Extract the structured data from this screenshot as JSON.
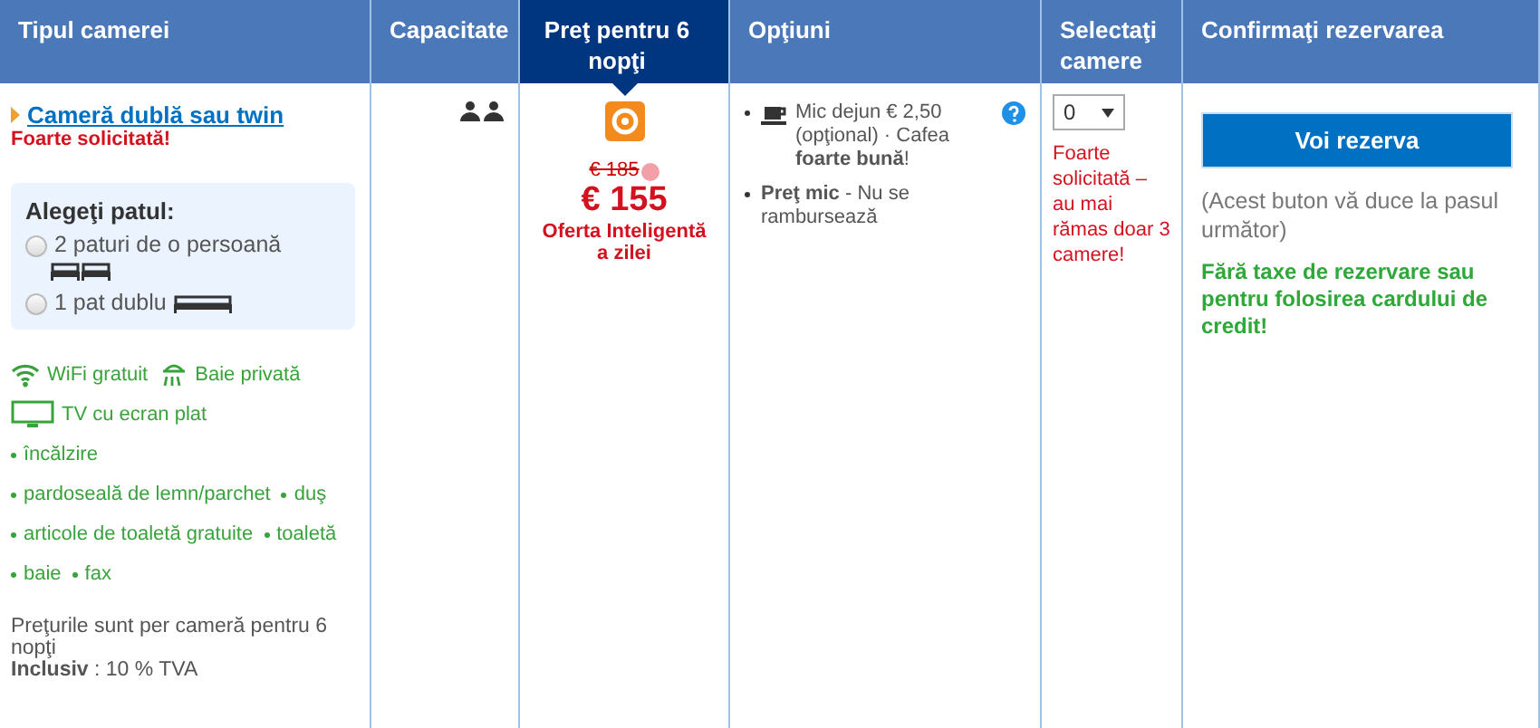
{
  "columns": [
    {
      "label": "Tipul camerei",
      "selected": false
    },
    {
      "label": "Capacitate",
      "selected": false
    },
    {
      "label": "Preţ pentru 6 nopţi",
      "selected": true
    },
    {
      "label": "Opţiuni",
      "selected": false
    },
    {
      "label": "Selectaţi camere",
      "selected": false
    },
    {
      "label": "Confirmaţi rezervarea",
      "selected": false
    }
  ],
  "room": {
    "name": "Cameră dublă sau twin",
    "demand": "Foarte solicitată!",
    "bed_choice": {
      "title": "Alegeţi patul:",
      "options": [
        {
          "label": "2 paturi de o persoană",
          "selected": false,
          "kind": "twin"
        },
        {
          "label": "1 pat dublu",
          "selected": false,
          "kind": "double"
        }
      ]
    },
    "facility_lines": [
      [
        {
          "label": "WiFi gratuit",
          "kind": "wifi"
        },
        {
          "label": "Baie privată",
          "kind": "bath"
        }
      ],
      [
        {
          "label": "TV cu ecran plat",
          "kind": "tv"
        }
      ],
      [
        {
          "label": "încălzire",
          "kind": "bullet"
        }
      ],
      [
        {
          "label": "pardoseală de lemn/parchet",
          "kind": "bullet"
        },
        {
          "label": "duş",
          "kind": "bullet"
        }
      ],
      [
        {
          "label": "articole de toaletă gratuite",
          "kind": "bullet"
        },
        {
          "label": "toaletă",
          "kind": "bullet"
        }
      ],
      [
        {
          "label": "baie",
          "kind": "bullet"
        },
        {
          "label": "fax",
          "kind": "bullet"
        }
      ]
    ],
    "price_note": "Preţurile sunt per cameră pentru 6 nopţi",
    "tax_note": "**Inclusiv** : 10 % TVA"
  },
  "price": {
    "old": "€ 185",
    "current": "€ 155",
    "deal": "Oferta Inteligentă a zilei"
  },
  "options": [
    {
      "text": "Mic dejun € 2,50 (opţional) · Cafea **foarte bună**!",
      "kind": "breakfast"
    },
    {
      "text": "**Preţ mic** - Nu se rambursează",
      "kind": "plain"
    }
  ],
  "select": {
    "value": "0",
    "note": "Foarte solicitată – au mai rămas doar 3 camere!"
  },
  "confirm": {
    "button": "Voi rezerva",
    "hint": "(Acest buton vă duce la pasul următor)",
    "free_note": "Fără taxe de rezervare sau pentru folosirea cardului de credit!"
  }
}
